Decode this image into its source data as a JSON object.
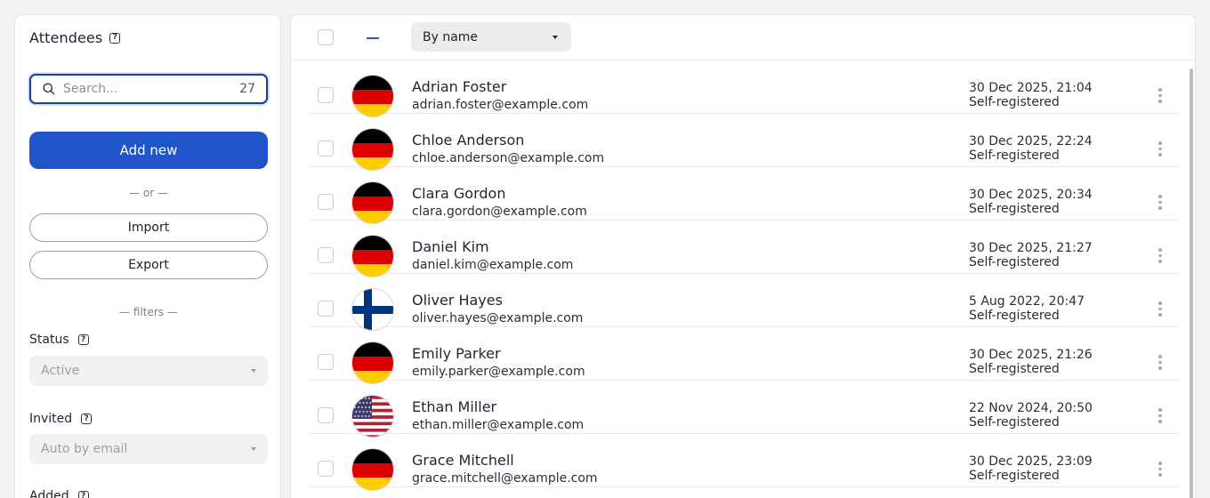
{
  "sidebar": {
    "title": "Attendees",
    "help_glyph": "?",
    "search": {
      "placeholder": "Search...",
      "count": "27"
    },
    "add_new_label": "Add new",
    "or_label": "— or —",
    "import_label": "Import",
    "export_label": "Export",
    "filters_label": "— filters —",
    "filters": [
      {
        "label": "Status",
        "value": "Active"
      },
      {
        "label": "Invited",
        "value": "Auto by email"
      },
      {
        "label": "Added"
      }
    ]
  },
  "toolbar": {
    "sort_value": "By name"
  },
  "attendees": [
    {
      "name": "Adrian Foster",
      "email": "adrian.foster@example.com",
      "date": "30 Dec 2025, 21:04",
      "source": "Self-registered",
      "flag": "de"
    },
    {
      "name": "Chloe Anderson",
      "email": "chloe.anderson@example.com",
      "date": "30 Dec 2025, 22:24",
      "source": "Self-registered",
      "flag": "de"
    },
    {
      "name": "Clara Gordon",
      "email": "clara.gordon@example.com",
      "date": "30 Dec 2025, 20:34",
      "source": "Self-registered",
      "flag": "de"
    },
    {
      "name": "Daniel Kim",
      "email": "daniel.kim@example.com",
      "date": "30 Dec 2025, 21:27",
      "source": "Self-registered",
      "flag": "de"
    },
    {
      "name": "Oliver Hayes",
      "email": "oliver.hayes@example.com",
      "date": "5 Aug 2022, 20:47",
      "source": "Self-registered",
      "flag": "fi"
    },
    {
      "name": "Emily Parker",
      "email": "emily.parker@example.com",
      "date": "30 Dec 2025, 21:26",
      "source": "Self-registered",
      "flag": "de"
    },
    {
      "name": "Ethan Miller",
      "email": "ethan.miller@example.com",
      "date": "22 Nov 2024, 20:50",
      "source": "Self-registered",
      "flag": "us"
    },
    {
      "name": "Grace Mitchell",
      "email": "grace.mitchell@example.com",
      "date": "30 Dec 2025, 23:09",
      "source": "Self-registered",
      "flag": "de"
    }
  ],
  "colors": {
    "primary": "#1f55c8",
    "focus_border": "#1d3f9c",
    "flag_de": [
      "#000000",
      "#dd0000",
      "#ffcc00"
    ],
    "flag_fi": [
      "#ffffff",
      "#003580"
    ]
  }
}
